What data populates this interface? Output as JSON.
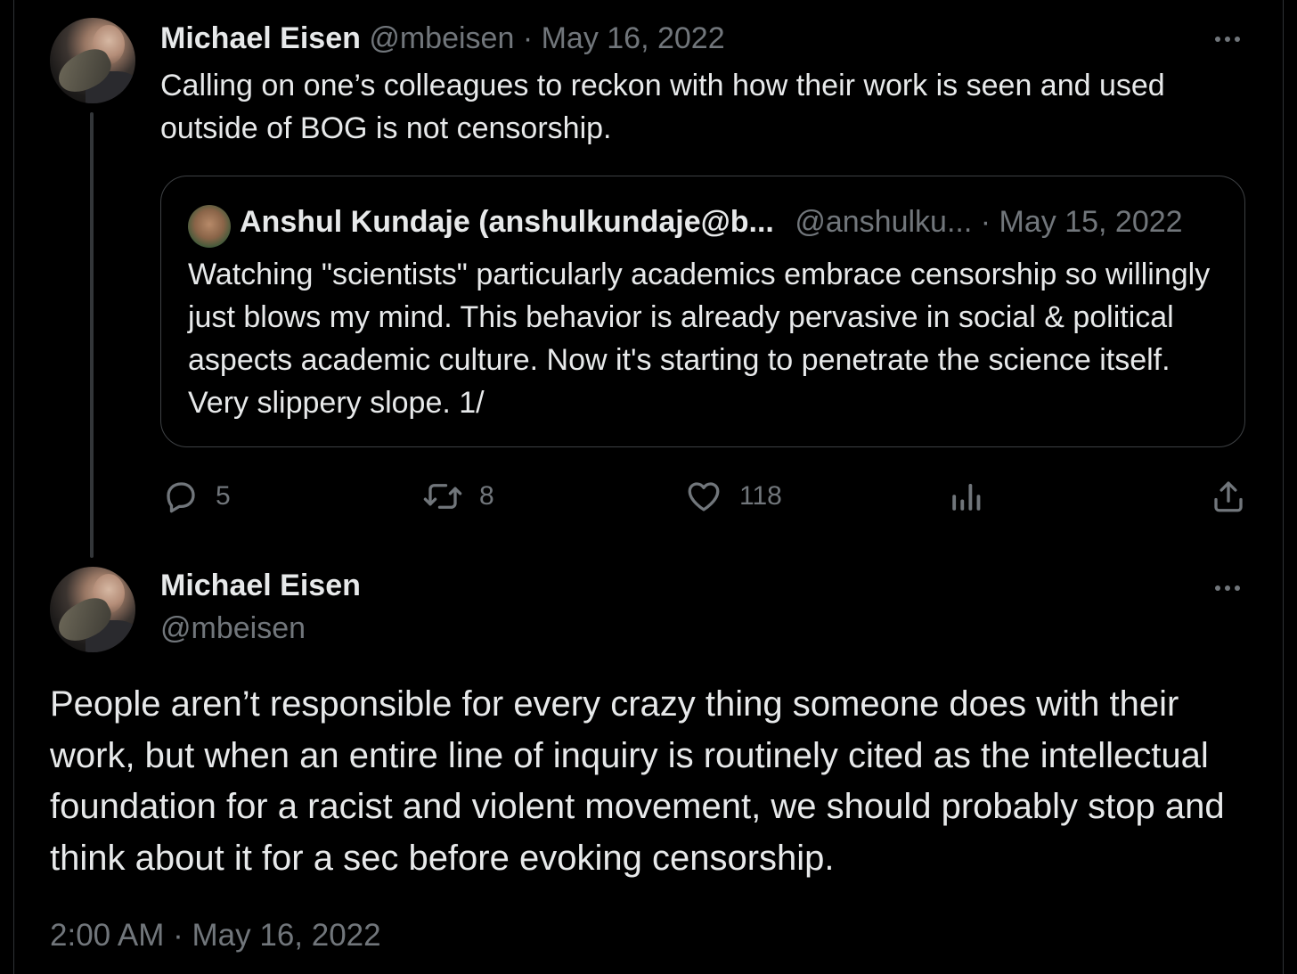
{
  "parent_tweet": {
    "author_name": "Michael Eisen",
    "author_handle": "@mbeisen",
    "separator": "·",
    "date": "May 16, 2022",
    "text": "Calling on one’s colleagues to reckon with how their work is seen and used outside of BOG is not censorship.",
    "quote": {
      "author_name": "Anshul Kundaje (anshulkundaje@b...",
      "author_handle": "@anshulku...",
      "separator": "·",
      "date": "May 15, 2022",
      "text": "Watching \"scientists\" particularly academics embrace censorship so willingly just blows my mind. This behavior is already pervasive in social & political aspects academic culture. Now it's starting to penetrate the science itself. Very slippery slope. 1/"
    },
    "actions": {
      "replies": "5",
      "reposts": "8",
      "likes": "118"
    }
  },
  "main_tweet": {
    "author_name": "Michael Eisen",
    "author_handle": "@mbeisen",
    "text": "People aren’t responsible for every crazy thing someone does with their work, but when an entire line of inquiry is routinely cited as the intellectual foundation for a racist and violent movement, we should probably stop and think about it for a sec before evoking censorship.",
    "timestamp": "2:00 AM · May 16, 2022"
  },
  "icons": [
    "more-icon",
    "reply-icon",
    "repost-icon",
    "like-icon",
    "views-icon",
    "share-icon"
  ],
  "colors": {
    "background": "#000000",
    "text": "#e7e9ea",
    "muted": "#71767b",
    "border": "#2f3336"
  }
}
